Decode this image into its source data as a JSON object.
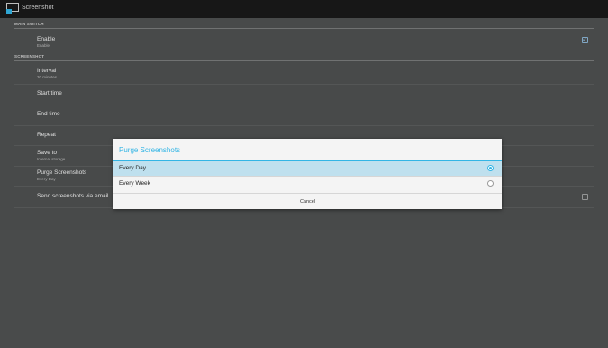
{
  "app": {
    "title": "Screenshot",
    "icon": "screenshot-app-icon"
  },
  "sections": {
    "main_switch": "MAIN SWITCH",
    "screenshot": "SCREENSHOT"
  },
  "rows": {
    "enable": {
      "title": "Enable",
      "summary": "Enable",
      "checked": true
    },
    "interval": {
      "title": "Interval",
      "summary": "30 minutes"
    },
    "start_time": {
      "title": "Start time"
    },
    "end_time": {
      "title": "End time"
    },
    "repeat": {
      "title": "Repeat"
    },
    "save_to": {
      "title": "Save to",
      "summary": "Internal storage"
    },
    "purge": {
      "title": "Purge Screenshots",
      "summary": "Every Day"
    },
    "send_email": {
      "title": "Send screenshots via email",
      "checked": false
    }
  },
  "dialog": {
    "title": "Purge Screenshots",
    "options": [
      {
        "label": "Every Day",
        "selected": true
      },
      {
        "label": "Every Week",
        "selected": false
      }
    ],
    "cancel_label": "Cancel"
  },
  "colors": {
    "accent": "#33b5e5",
    "background": "#4f5151",
    "actionbar": "#1a1a1a"
  }
}
